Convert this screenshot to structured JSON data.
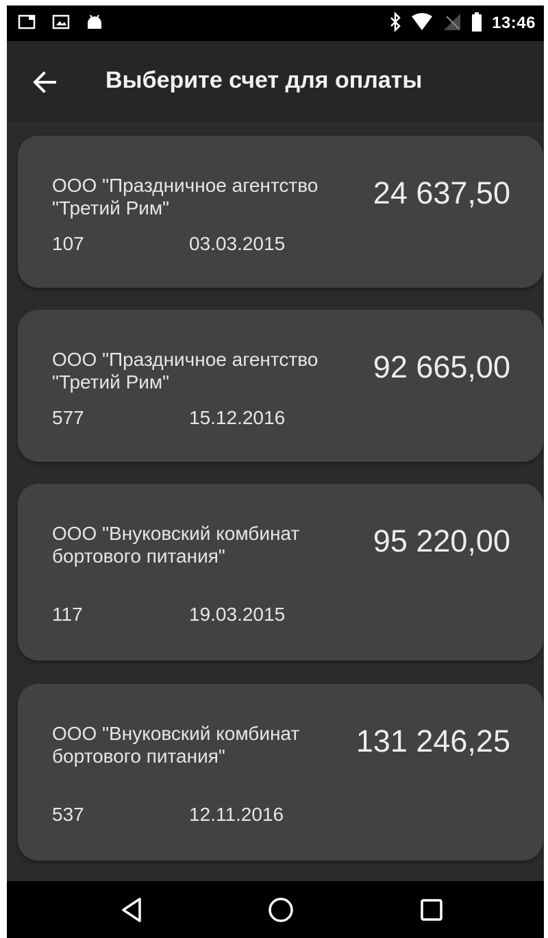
{
  "status_bar": {
    "time": "13:46",
    "icons_left": [
      "screencast-icon",
      "image-icon",
      "android-icon"
    ],
    "icons_right": [
      "bluetooth-icon",
      "wifi-icon",
      "no-sim-icon",
      "battery-icon"
    ]
  },
  "toolbar": {
    "title": "Выберите счет для оплаты",
    "back_icon": "arrow-left-icon"
  },
  "invoices": [
    {
      "company": "ООО \"Праздничное агентство \"Третий Рим\"",
      "amount": "24 637,50",
      "number": "107",
      "date": "03.03.2015"
    },
    {
      "company": "ООО \"Праздничное агентство \"Третий Рим\"",
      "amount": "92 665,00",
      "number": "577",
      "date": "15.12.2016"
    },
    {
      "company": "ООО \"Внуковский комбинат бортового питания\"",
      "amount": "95 220,00",
      "number": "117",
      "date": "19.03.2015"
    },
    {
      "company": "ООО \"Внуковский комбинат бортового питания\"",
      "amount": "131 246,25",
      "number": "537",
      "date": "12.11.2016"
    }
  ],
  "nav_bar": {
    "icons": [
      "back-triangle-icon",
      "home-circle-icon",
      "recents-square-icon"
    ]
  },
  "colors": {
    "background": "#2b2b2b",
    "card": "#424242",
    "toolbar": "#262626",
    "text": "#e6e6e6"
  }
}
